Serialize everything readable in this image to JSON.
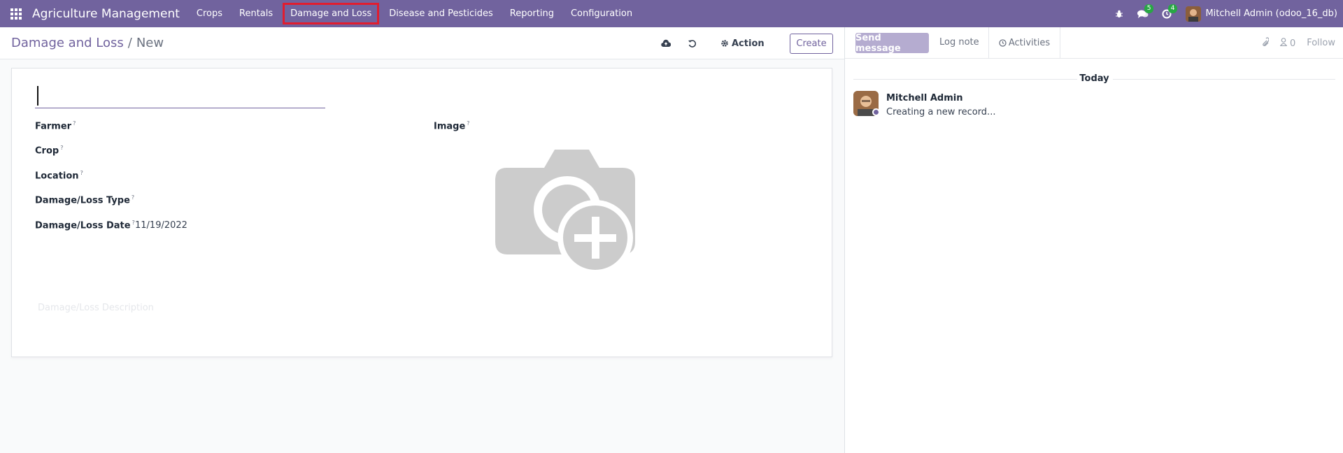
{
  "navbar": {
    "brand": "Agriculture Management",
    "menu": [
      "Crops",
      "Rentals",
      "Damage and Loss",
      "Disease and Pesticides",
      "Reporting",
      "Configuration"
    ],
    "messages_badge": "5",
    "activities_badge": "4",
    "user": "Mitchell Admin (odoo_16_db)"
  },
  "breadcrumb": {
    "parent": "Damage and Loss",
    "separator": "/",
    "current": "New"
  },
  "toolbar": {
    "action_label": "Action",
    "create_label": "Create"
  },
  "form": {
    "fields": [
      {
        "label": "Farmer",
        "help": "?",
        "value": ""
      },
      {
        "label": "Crop",
        "help": "?",
        "value": ""
      },
      {
        "label": "Location",
        "help": "?",
        "value": ""
      },
      {
        "label": "Damage/Loss Type",
        "help": "?",
        "value": ""
      },
      {
        "label": "Damage/Loss Date",
        "help": "?",
        "value": "11/19/2022"
      }
    ],
    "image_label": "Image",
    "image_help": "?",
    "description_placeholder": "Damage/Loss Description"
  },
  "chatter": {
    "send_message": "Send message",
    "log_note": "Log note",
    "activities": "Activities",
    "followers_count": "0",
    "follow": "Follow",
    "date_separator": "Today",
    "message": {
      "author": "Mitchell Admin",
      "body": "Creating a new record..."
    }
  },
  "colors": {
    "brand": "#71639e",
    "highlight": "#e11d2f",
    "badge": "#28a745"
  }
}
